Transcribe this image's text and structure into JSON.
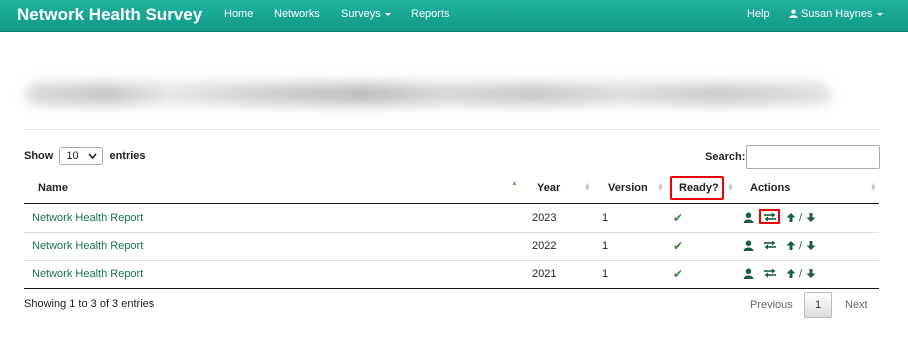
{
  "navbar": {
    "brand": "Network Health Survey",
    "items": [
      {
        "label": "Home"
      },
      {
        "label": "Networks"
      },
      {
        "label": "Surveys",
        "dropdown": true
      },
      {
        "label": "Reports"
      }
    ],
    "help": "Help",
    "user": "Susan Haynes",
    "bg_color": "#14a391"
  },
  "table_controls": {
    "show_label": "Show",
    "entries_value": "10",
    "entries_label": "entries",
    "search_label": "Search:",
    "search_value": ""
  },
  "table": {
    "columns": [
      "Name",
      "Year",
      "Version",
      "Ready?",
      "Actions"
    ],
    "sorted_column": "Name",
    "sort_direction": "asc",
    "rows": [
      {
        "name": "Network Health Report",
        "year": "2023",
        "version": "1",
        "ready": true,
        "slash": "/"
      },
      {
        "name": "Network Health Report",
        "year": "2022",
        "version": "1",
        "ready": true,
        "slash": "/"
      },
      {
        "name": "Network Health Report",
        "year": "2021",
        "version": "1",
        "ready": true,
        "slash": "/"
      }
    ],
    "link_color": "#1a6f52",
    "action_icons": [
      "user-icon",
      "swap-arrows-icon",
      "arrow-up-icon",
      "arrow-down-icon"
    ]
  },
  "footer": {
    "info": "Showing 1 to 3 of 3 entries",
    "previous": "Previous",
    "current_page": "1",
    "next": "Next"
  },
  "highlight_color": "#e00000"
}
